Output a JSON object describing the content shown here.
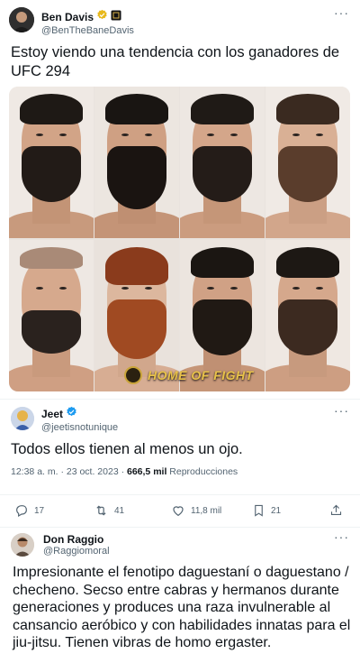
{
  "tweet1": {
    "author_name": "Ben Davis",
    "handle": "@BenTheBaneDavis",
    "text": "Estoy viendo una tendencia con los ganadores de UFC 294",
    "image_watermark": "HOME OF FIGHT",
    "more_label": "···"
  },
  "tweet2": {
    "author_name": "Jeet",
    "handle": "@jeetisnotunique",
    "text": "Todos ellos tienen al menos un ojo.",
    "time": "12:38 a. m. · 23 oct. 2023 ·",
    "views_count": "666,5 mil",
    "views_label": "Reproducciones",
    "more_label": "···",
    "actions": {
      "reply_count": "17",
      "retweet_count": "41",
      "like_count": "11,8 mil",
      "bookmark_count": "21"
    }
  },
  "tweet3": {
    "author_name": "Don Raggio",
    "handle": "@Raggiomoral",
    "text": "Impresionante el fenotipo daguestaní o daguestano / checheno. Secso entre cabras y hermanos durante generaciones y produces una raza invulnerable al cansancio aeróbico y con habilidades innatas para el jiu-jitsu. Tienen vibras de homo ergaster.",
    "more_label": "···"
  },
  "colors": {
    "verified_blue": "#1d9bf0",
    "secondary_text": "#536471",
    "primary_text": "#0f1419",
    "divider": "#eff3f4"
  },
  "icons": [
    "verified-badge-icon",
    "gold-badge-icon",
    "reply-icon",
    "retweet-icon",
    "like-icon",
    "bookmark-icon",
    "share-icon",
    "more-icon"
  ]
}
